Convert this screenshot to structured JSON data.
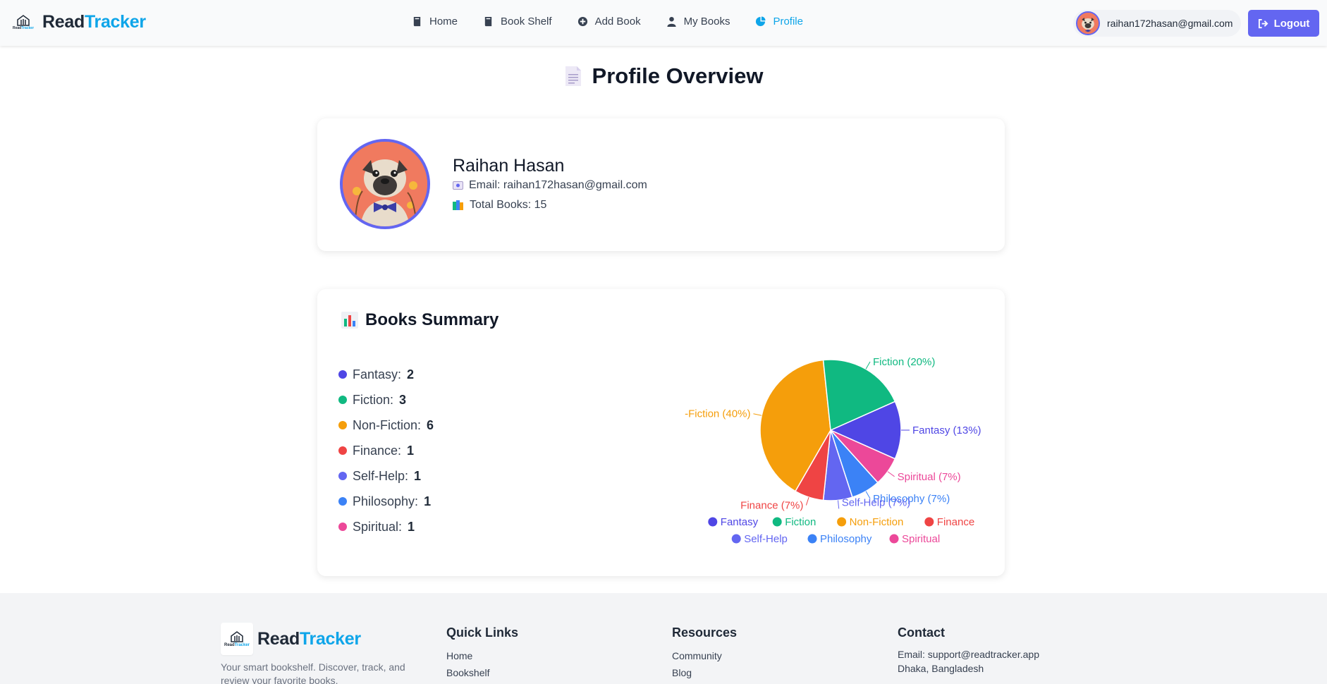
{
  "nav": {
    "brand_part1": "Read",
    "brand_part2": "Tracker",
    "logo_small_part1": "Read",
    "logo_small_part2": "Tracker",
    "links": [
      {
        "label": "Home",
        "icon": "book-icon"
      },
      {
        "label": "Book Shelf",
        "icon": "book-icon"
      },
      {
        "label": "Add Book",
        "icon": "plus-circle-icon"
      },
      {
        "label": "My Books",
        "icon": "user-icon"
      },
      {
        "label": "Profile",
        "icon": "chart-pie-icon",
        "active": true
      }
    ],
    "user_email": "raihan172hasan@gmail.com",
    "logout_label": "Logout"
  },
  "page": {
    "title": "Profile Overview"
  },
  "profile": {
    "name": "Raihan Hasan",
    "email_text": "Email: raihan172hasan@gmail.com",
    "total_text": "Total Books: 15"
  },
  "summary": {
    "title": "Books Summary",
    "items": [
      {
        "label": "Fantasy:",
        "count": "2"
      },
      {
        "label": "Fiction:",
        "count": "3"
      },
      {
        "label": "Non-Fiction:",
        "count": "6"
      },
      {
        "label": "Finance:",
        "count": "1"
      },
      {
        "label": "Self-Help:",
        "count": "1"
      },
      {
        "label": "Philosophy:",
        "count": "1"
      },
      {
        "label": "Spiritual:",
        "count": "1"
      }
    ]
  },
  "chart_data": {
    "type": "pie",
    "categories": [
      "Fantasy",
      "Fiction",
      "Non-Fiction",
      "Finance",
      "Self-Help",
      "Philosophy",
      "Spiritual"
    ],
    "values": [
      2,
      3,
      6,
      1,
      1,
      1,
      1
    ],
    "slice_labels": [
      "Fantasy (13%)",
      "Fiction (20%)",
      "-Fiction (40%)",
      "Finance (7%)",
      "Self-Help (7%)",
      "Philosophy (7%)",
      "Spiritual (7%)"
    ],
    "colors": [
      "#4f46e5",
      "#10b981",
      "#f59e0b",
      "#ef4444",
      "#6366f1",
      "#3b82f6",
      "#ec4899"
    ],
    "legend_position": "bottom"
  },
  "footer": {
    "brand_part1": "Read",
    "brand_part2": "Tracker",
    "tagline": "Your smart bookshelf. Discover, track, and review your favorite books.",
    "quick_links": {
      "title": "Quick Links",
      "items": [
        "Home",
        "Bookshelf"
      ]
    },
    "resources": {
      "title": "Resources",
      "items": [
        "Community",
        "Blog"
      ]
    },
    "contact": {
      "title": "Contact",
      "email": "Email: support@readtracker.app",
      "location": "Dhaka, Bangladesh"
    }
  }
}
